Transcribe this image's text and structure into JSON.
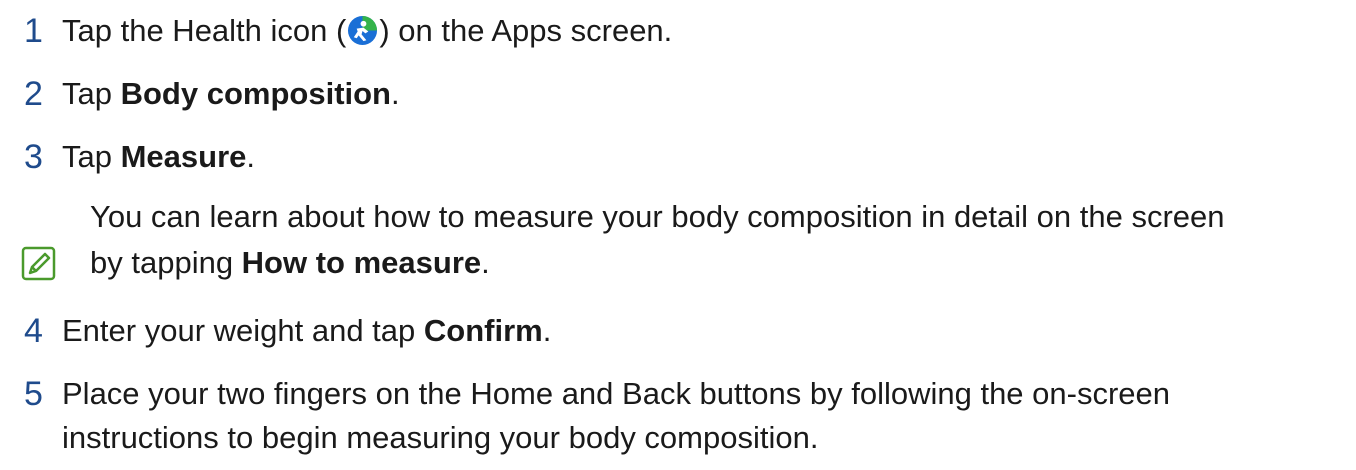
{
  "steps": [
    {
      "number": "1",
      "before": "Tap the Health icon (",
      "after": ") on the Apps screen.",
      "icon": "health-app-icon"
    },
    {
      "number": "2",
      "before": "Tap ",
      "bold": "Body composition",
      "after": "."
    },
    {
      "number": "3",
      "before": "Tap ",
      "bold": "Measure",
      "after": "."
    },
    {
      "number": "4",
      "before": "Enter your weight and tap ",
      "bold": "Confirm",
      "after": "."
    },
    {
      "number": "5",
      "line1": "Place your two fingers on the Home and Back buttons by following the on-screen",
      "line2": "instructions to begin measuring your body composition."
    }
  ],
  "note": {
    "icon": "note-pencil-icon",
    "line1": "You can learn about how to measure your body composition in detail on the screen",
    "line2_before": "by tapping ",
    "line2_bold": "How to measure",
    "line2_after": "."
  },
  "colors": {
    "step_number": "#1f4b8c",
    "note_icon": "#4a9a2c",
    "health_icon_blue": "#1a6fd6",
    "health_icon_green": "#34b34a"
  }
}
